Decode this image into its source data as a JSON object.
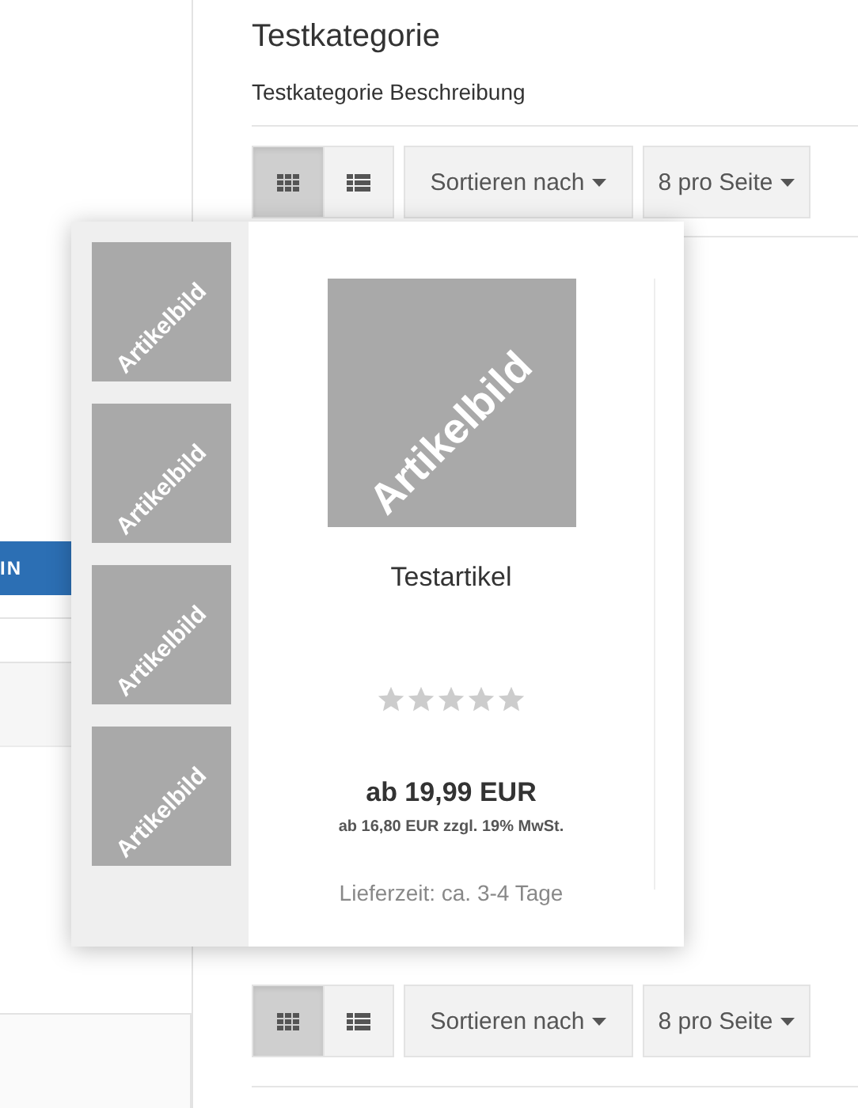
{
  "sidebar": {
    "login_button": "IN"
  },
  "category": {
    "title": "Testkategorie",
    "description": "Testkategorie Beschreibung"
  },
  "toolbars": [
    {
      "views": [
        {
          "kind": "grid",
          "selected": true
        },
        {
          "kind": "list",
          "selected": false
        }
      ],
      "sort": "Sortieren nach",
      "per_page": "8 pro Seite"
    },
    {
      "views": [
        {
          "kind": "grid",
          "selected": true
        },
        {
          "kind": "list",
          "selected": false
        }
      ],
      "sort": "Sortieren nach",
      "per_page": "8 pro Seite"
    }
  ],
  "product_popup": {
    "thumbnails": [
      "Artikelbild",
      "Artikelbild",
      "Artikelbild",
      "Artikelbild"
    ],
    "image_label": "Artikelbild",
    "name": "Testartikel",
    "stars": 0,
    "price": "ab 19,99 EUR",
    "net_price": "ab 16,80 EUR zzgl. 19% MwSt.",
    "delivery": "Lieferzeit: ca. 3-4 Tage"
  }
}
